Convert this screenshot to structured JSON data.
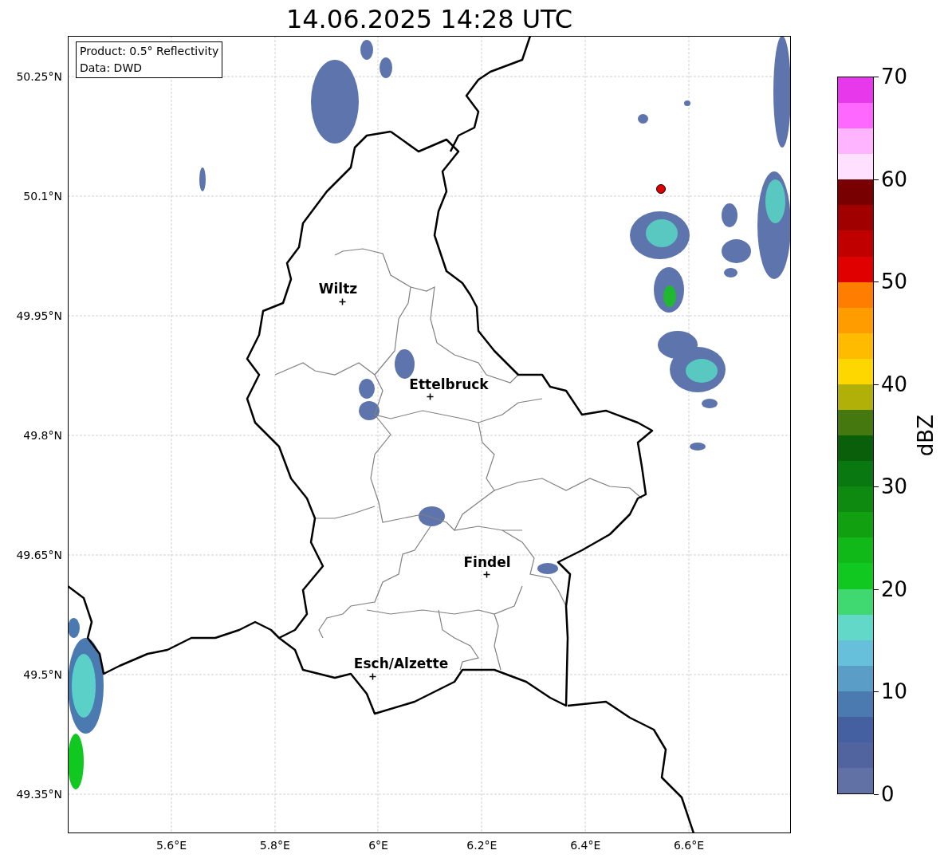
{
  "title": "14.06.2025 14:28 UTC",
  "info_box": [
    "Product: 0.5° Reflectivity",
    "Data: DWD"
  ],
  "map": {
    "y_ticks": [
      "50.25°N",
      "50.1°N",
      "49.95°N",
      "49.8°N",
      "49.65°N",
      "49.5°N",
      "49.35°N"
    ],
    "x_ticks": [
      "5.6°E",
      "5.8°E",
      "6°E",
      "6.2°E",
      "6.4°E",
      "6.6°E"
    ],
    "cities": [
      {
        "name": "Wiltz"
      },
      {
        "name": "Ettelbruck"
      },
      {
        "name": "Findel"
      },
      {
        "name": "Esch/Alzette"
      }
    ]
  },
  "colorbar": {
    "label": "dBZ",
    "ticks": [
      "70",
      "60",
      "50",
      "40",
      "30",
      "20",
      "10",
      "0"
    ],
    "bands": [
      {
        "color": "#e838ec"
      },
      {
        "color": "#ff68ff"
      },
      {
        "color": "#ffb4ff"
      },
      {
        "color": "#ffe0ff"
      },
      {
        "color": "#780000"
      },
      {
        "color": "#a00000"
      },
      {
        "color": "#c00000"
      },
      {
        "color": "#e00000"
      },
      {
        "color": "#ff7d00"
      },
      {
        "color": "#ff9c00"
      },
      {
        "color": "#ffbb00"
      },
      {
        "color": "#ffd700"
      },
      {
        "color": "#b0b008"
      },
      {
        "color": "#467810"
      },
      {
        "color": "#0a600a"
      },
      {
        "color": "#0a7810"
      },
      {
        "color": "#0e8a10"
      },
      {
        "color": "#10a010"
      },
      {
        "color": "#10b818"
      },
      {
        "color": "#10c820"
      },
      {
        "color": "#40d870"
      },
      {
        "color": "#62d8c8"
      },
      {
        "color": "#66c0dc"
      },
      {
        "color": "#5a9ec8"
      },
      {
        "color": "#4a7ab0"
      },
      {
        "color": "#4460a0"
      },
      {
        "color": "#5264a0"
      },
      {
        "color": "#6171a6"
      }
    ]
  }
}
